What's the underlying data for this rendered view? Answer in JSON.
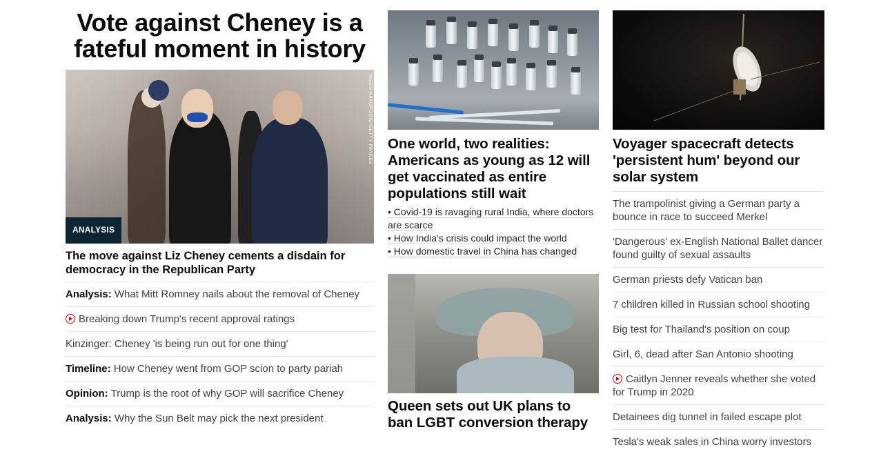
{
  "col1": {
    "headline": "Vote against Cheney is a fateful moment in history",
    "image": {
      "badge": "ANALYSIS",
      "credit": "TASOS KATOPODIS/GETTY IMAGES"
    },
    "story_headline": "The move against Liz Cheney cements a disdain for democracy in the Republican Party",
    "links": [
      {
        "prefix": "Analysis:",
        "text": "What Mitt Romney nails about the removal of Cheney",
        "video": false
      },
      {
        "prefix": "",
        "text": "Breaking down Trump's recent approval ratings",
        "video": true
      },
      {
        "prefix": "",
        "text": "Kinzinger: Cheney 'is being run out for one thing'",
        "video": false
      },
      {
        "prefix": "Timeline:",
        "text": "How Cheney went from GOP scion to party pariah",
        "video": false
      },
      {
        "prefix": "Opinion:",
        "text": "Trump is the root of why GOP will sacrifice Cheney",
        "video": false
      },
      {
        "prefix": "Analysis:",
        "text": "Why the Sun Belt may pick the next president",
        "video": false
      }
    ]
  },
  "col2": {
    "story1": {
      "headline": "One world, two realities: Americans as young as 12 will get vaccinated as entire populations still wait",
      "bullets": [
        "Covid-19 is ravaging rural India, where doctors are scarce",
        "How India's crisis could impact the world",
        "How domestic travel in China has changed"
      ]
    },
    "story2": {
      "headline": "Queen sets out UK plans to ban LGBT conversion therapy"
    }
  },
  "col3": {
    "headline": "Voyager spacecraft detects 'persistent hum' beyond our solar system",
    "links": [
      {
        "text": "The trampolinist giving a German party a bounce in race to succeed Merkel",
        "video": false
      },
      {
        "text": "'Dangerous' ex-English National Ballet dancer found guilty of sexual assaults",
        "video": false
      },
      {
        "text": "German priests defy Vatican ban",
        "video": false
      },
      {
        "text": "7 children killed in Russian school shooting",
        "video": false
      },
      {
        "text": "Big test for Thailand's position on coup",
        "video": false
      },
      {
        "text": "Girl, 6, dead after San Antonio shooting",
        "video": false
      },
      {
        "text": "Caitlyn Jenner reveals whether she voted for Trump in 2020",
        "video": true
      },
      {
        "text": "Detainees dig tunnel in failed escape plot",
        "video": false
      },
      {
        "text": "Tesla's weak sales in China worry investors",
        "video": false
      }
    ]
  },
  "colors": {
    "video_red": "#cc0000",
    "badge_bg": "#0c2533"
  }
}
